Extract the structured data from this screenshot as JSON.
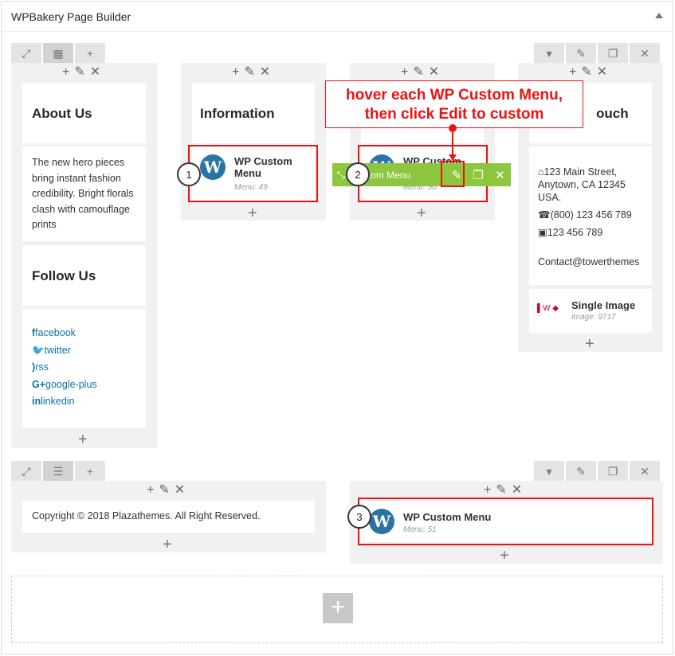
{
  "panel": {
    "title": "WPBakery Page Builder"
  },
  "icons": {
    "expand": "⤢",
    "layout": "▦",
    "plus": "+",
    "pencil": "✎",
    "close": "✕",
    "duplicate": "❐",
    "caret": "▾",
    "lines": "☰",
    "move": "⤡"
  },
  "row1": {
    "col1": {
      "about_heading": "About Us",
      "about_text": "The new hero pieces bring instant fashion credibility. Bright florals clash with camouflage prints",
      "follow_heading": "Follow Us",
      "social": [
        "facebook",
        "twitter",
        "rss",
        "google-plus",
        "linkedin"
      ]
    },
    "col2": {
      "heading": "Information",
      "menu": {
        "title": "WP Custom Menu",
        "sub": "Menu: 49",
        "badge": "1"
      }
    },
    "col3": {
      "heading": "",
      "menu": {
        "title": "WP Custom",
        "sub": "Menu: 50",
        "badge": "2"
      },
      "hover_label": "Custom Menu"
    },
    "col4": {
      "heading_fragment": "ouch",
      "address": "123 Main Street, Anytown, CA 12345 USA.",
      "phone": "(800) 123 456 789",
      "fax": "123 456 789",
      "email": "Contact@towerthemes",
      "image_title": "Single Image",
      "image_sub": "Image: 9717"
    }
  },
  "callout": {
    "line1": "hover each WP Custom Menu,",
    "line2": "then click Edit to custom"
  },
  "row2": {
    "copyright": "Copyright © 2018 Plazathemes. All Right Reserved.",
    "menu": {
      "title": "WP Custom Menu",
      "sub": "Menu: 51",
      "badge": "3"
    }
  },
  "colors": {
    "accent_green": "#8dc63f",
    "annotation_red": "#ee1111",
    "wp_blue": "#2a74a5"
  }
}
